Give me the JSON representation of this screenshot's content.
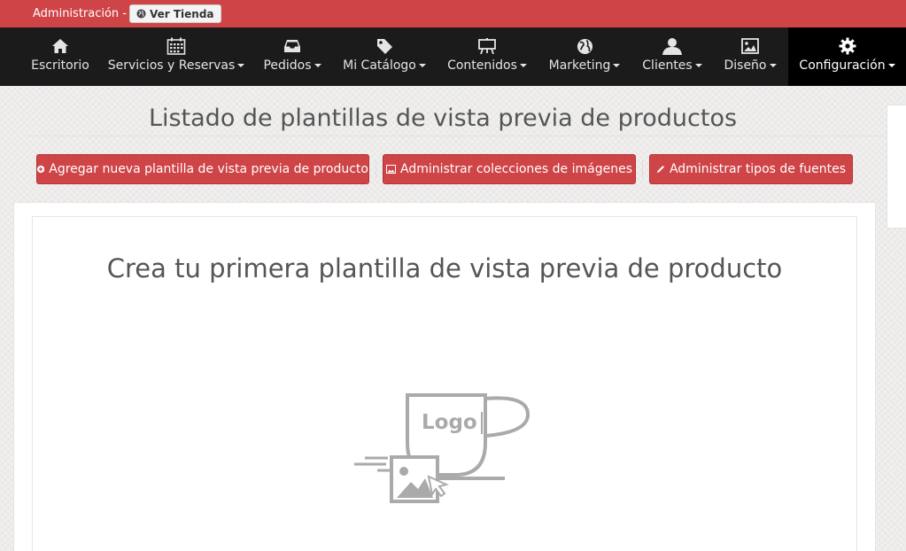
{
  "admin_bar": {
    "label": "Administración -",
    "store_button": "Ver Tienda",
    "store_icon": "globe-icon"
  },
  "nav": {
    "items": [
      {
        "label": "Escritorio",
        "icon": "home-icon",
        "dropdown": false
      },
      {
        "label": "Servicios y Reservas",
        "icon": "calendar-icon",
        "dropdown": true
      },
      {
        "label": "Pedidos",
        "icon": "inbox-icon",
        "dropdown": true
      },
      {
        "label": "Mi Catálogo",
        "icon": "tag-icon",
        "dropdown": true
      },
      {
        "label": "Contenidos",
        "icon": "easel-icon",
        "dropdown": true
      },
      {
        "label": "Marketing",
        "icon": "globe-icon",
        "dropdown": true
      },
      {
        "label": "Clientes",
        "icon": "user-icon",
        "dropdown": true
      },
      {
        "label": "Diseño",
        "icon": "picture-icon",
        "dropdown": true
      },
      {
        "label": "Configuración",
        "icon": "gear-icon",
        "dropdown": true,
        "active": true
      }
    ]
  },
  "page": {
    "title": "Listado de plantillas de vista previa de productos",
    "buttons": {
      "add_template": "Agregar nueva plantilla de vista previa de producto",
      "manage_collections": "Administrar colecciones de imágenes",
      "manage_fonts": "Administrar tipos de fuentes"
    },
    "empty_state": {
      "title": "Crea tu primera plantilla de vista previa de producto",
      "illustration_text": "Logo"
    }
  },
  "colors": {
    "brand_red": "#cf4447",
    "nav_bg": "#1b1b1b",
    "illustration_gray": "#aaaaaa"
  }
}
